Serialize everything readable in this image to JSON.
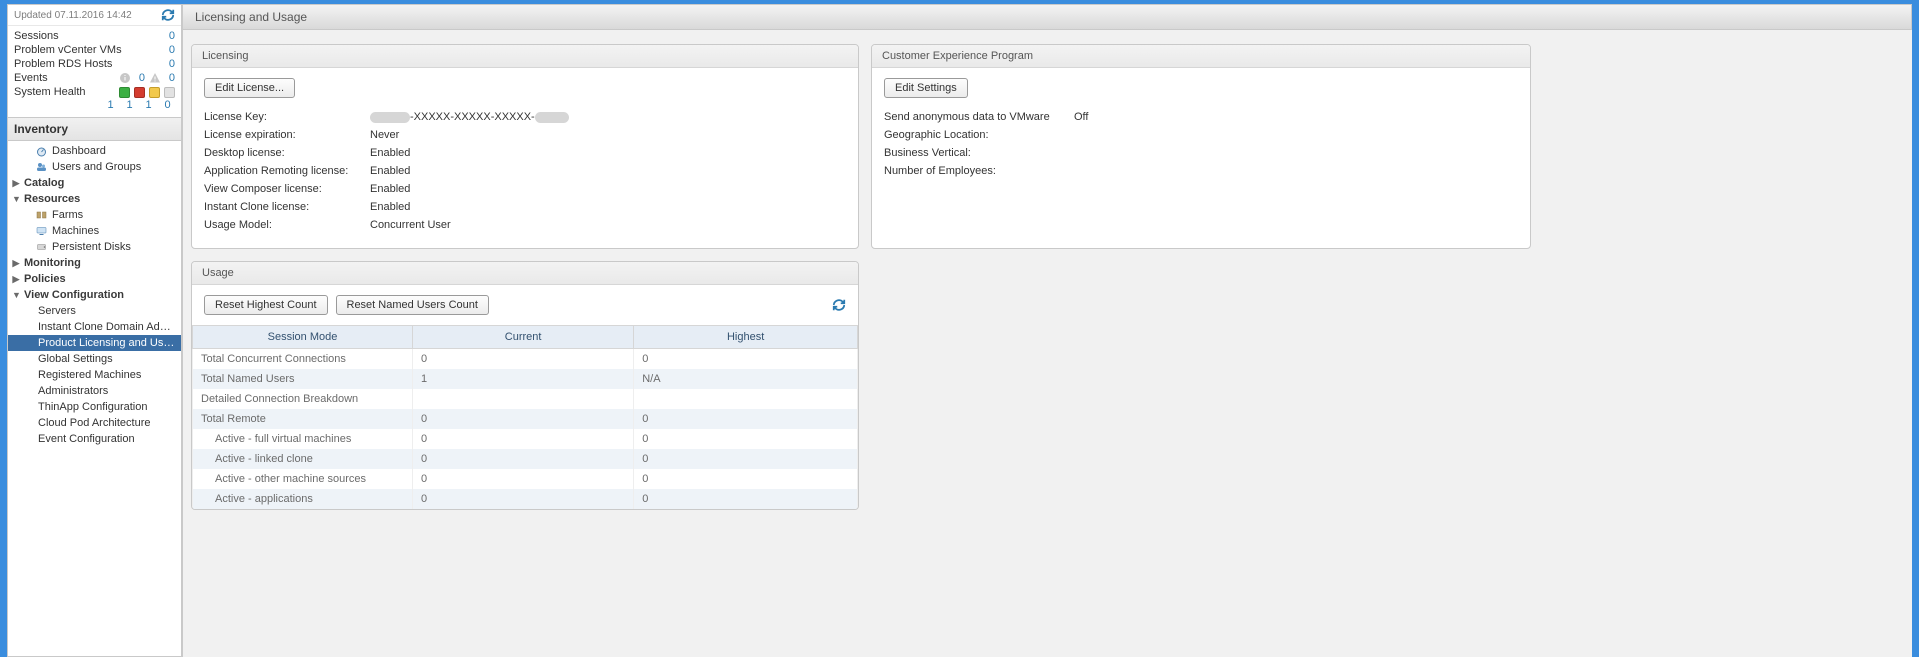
{
  "status": {
    "updated_label": "Updated 07.11.2016 14:42",
    "rows": {
      "sessions_label": "Sessions",
      "sessions_val": "0",
      "pvcvms_label": "Problem vCenter VMs",
      "pvcvms_val": "0",
      "prds_label": "Problem RDS Hosts",
      "prds_val": "0",
      "events_label": "Events",
      "events_info_val": "0",
      "events_warn_val": "0",
      "syshealth_label": "System Health",
      "syshealth_nums": {
        "a": "1",
        "b": "1",
        "c": "1",
        "d": "0"
      }
    }
  },
  "inventory": {
    "title": "Inventory",
    "dashboard": "Dashboard",
    "users": "Users and Groups",
    "catalog": "Catalog",
    "resources": "Resources",
    "farms": "Farms",
    "machines": "Machines",
    "pdisks": "Persistent Disks",
    "monitoring": "Monitoring",
    "policies": "Policies",
    "viewconfig": "View Configuration",
    "servers": "Servers",
    "icda": "Instant Clone Domain Admins",
    "plu": "Product Licensing and Usage",
    "gsettings": "Global Settings",
    "regmach": "Registered Machines",
    "admins": "Administrators",
    "thinapp": "ThinApp Configuration",
    "cpa": "Cloud Pod Architecture",
    "evconf": "Event Configuration"
  },
  "page": {
    "title": "Licensing and Usage"
  },
  "licensing": {
    "panel_title": "Licensing",
    "edit_btn": "Edit License...",
    "key_label": "License Key:",
    "key_mid": "-XXXXX-XXXXX-XXXXX-",
    "exp_label": "License expiration:",
    "exp_val": "Never",
    "desk_label": "Desktop license:",
    "desk_val": "Enabled",
    "appr_label": "Application Remoting license:",
    "appr_val": "Enabled",
    "vc_label": "View Composer license:",
    "vc_val": "Enabled",
    "ic_label": "Instant Clone license:",
    "ic_val": "Enabled",
    "um_label": "Usage Model:",
    "um_val": "Concurrent User"
  },
  "cep": {
    "panel_title": "Customer Experience Program",
    "edit_btn": "Edit Settings",
    "send_label": "Send anonymous data to VMware",
    "send_val": "Off",
    "geo_label": "Geographic Location:",
    "bv_label": "Business Vertical:",
    "emp_label": "Number of Employees:"
  },
  "usage": {
    "panel_title": "Usage",
    "reset_high_btn": "Reset Highest Count",
    "reset_named_btn": "Reset Named Users Count",
    "cols": {
      "mode": "Session Mode",
      "current": "Current",
      "highest": "Highest"
    },
    "rows": {
      "tcc_label": "Total Concurrent Connections",
      "tcc_cur": "0",
      "tcc_high": "0",
      "tnu_label": "Total Named Users",
      "tnu_cur": "1",
      "tnu_high": "N/A",
      "dcb_label": "Detailed Connection Breakdown",
      "tr_label": "Total Remote",
      "tr_cur": "0",
      "tr_high": "0",
      "afvm_label": "Active - full virtual machines",
      "afvm_cur": "0",
      "afvm_high": "0",
      "alc_label": "Active - linked clone",
      "alc_cur": "0",
      "alc_high": "0",
      "aoms_label": "Active - other machine sources",
      "aoms_cur": "0",
      "aoms_high": "0",
      "aapp_label": "Active - applications",
      "aapp_cur": "0",
      "aapp_high": "0"
    }
  }
}
